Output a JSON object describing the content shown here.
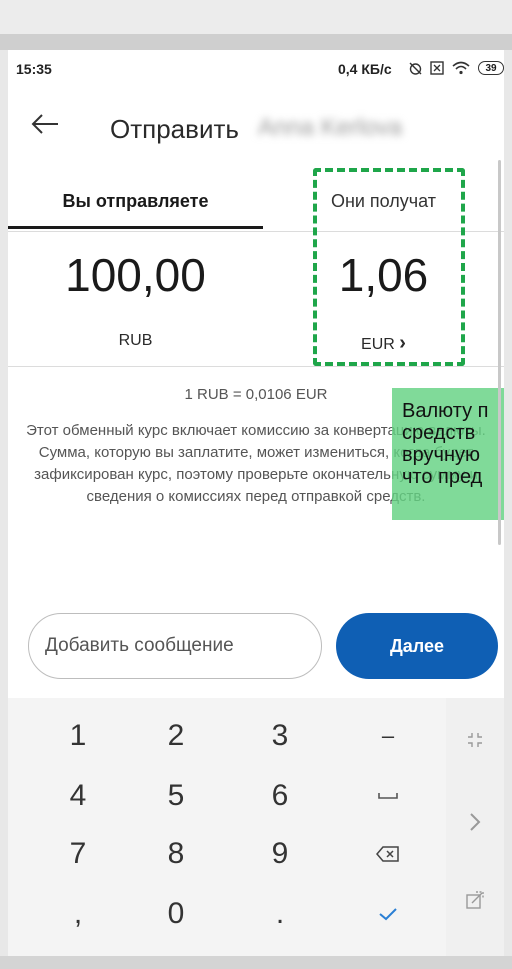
{
  "status_bar": {
    "time": "15:35",
    "network_speed": "0,4 КБ/с",
    "battery": "39",
    "icons": [
      "alarm-off-icon",
      "sim-icon",
      "wifi-icon",
      "battery-icon"
    ]
  },
  "header": {
    "title": "Отправить",
    "recipient": "Anna Kerlova"
  },
  "tabs": {
    "send_label": "Вы отправляете",
    "receive_label": "Они получат"
  },
  "amounts": {
    "send_value": "100,00",
    "send_currency": "RUB",
    "receive_value": "1,06",
    "receive_currency": "EUR",
    "receive_chevron": "›"
  },
  "rate": "1 RUB = 0,0106 EUR",
  "disclaimer": "Этот обменный курс включает комиссию за конвертацию валюты. Сумма, которую вы заплатите, может измениться, когда будет зафиксирован курс, поэтому проверьте окончательную сумму и сведения о комиссиях перед отправкой средств.",
  "tooltip": {
    "lines": [
      "Валюту п",
      "средств",
      "вручную",
      "что пред"
    ]
  },
  "message": {
    "placeholder": "Добавить сообщение"
  },
  "next_button": "Далее",
  "keypad": {
    "row1": [
      "1",
      "2",
      "3",
      "–"
    ],
    "row2": [
      "4",
      "5",
      "6",
      "␣"
    ],
    "row3": [
      "7",
      "8",
      "9",
      "⌫"
    ],
    "row4": [
      ",",
      "0",
      ".",
      "✓"
    ],
    "side": [
      "collapse-icon",
      "chevron-right-icon",
      "external-link-icon"
    ]
  },
  "colors": {
    "primary_button": "#0f5fb4",
    "highlight": "#1fa64a",
    "tooltip": "#64d282"
  }
}
